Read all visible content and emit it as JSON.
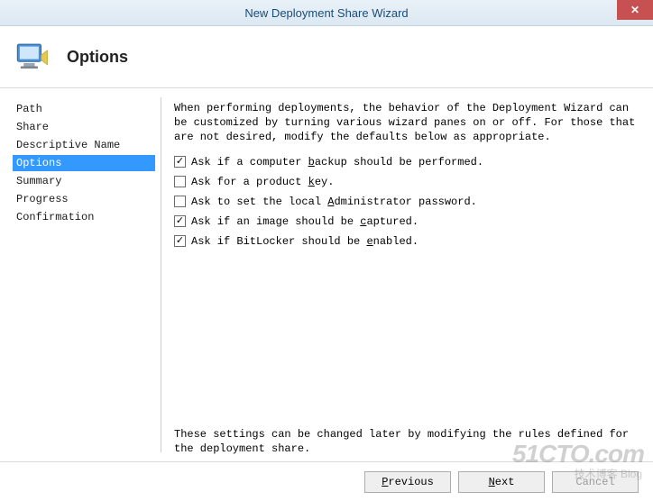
{
  "window": {
    "title": "New Deployment Share Wizard",
    "close_glyph": "✕"
  },
  "header": {
    "title": "Options"
  },
  "sidebar": {
    "items": [
      {
        "label": "Path",
        "selected": false
      },
      {
        "label": "Share",
        "selected": false
      },
      {
        "label": "Descriptive Name",
        "selected": false
      },
      {
        "label": "Options",
        "selected": true
      },
      {
        "label": "Summary",
        "selected": false
      },
      {
        "label": "Progress",
        "selected": false
      },
      {
        "label": "Confirmation",
        "selected": false
      }
    ]
  },
  "content": {
    "intro": "When performing deployments, the behavior of the Deployment Wizard can be customized by turning various wizard panes on or off.  For those that are not desired, modify the defaults below as appropriate.",
    "options": [
      {
        "checked": true,
        "pre": "Ask if a computer ",
        "u": "b",
        "post": "ackup should be performed."
      },
      {
        "checked": false,
        "pre": "Ask for a product ",
        "u": "k",
        "post": "ey."
      },
      {
        "checked": false,
        "pre": "Ask to set the local ",
        "u": "A",
        "post": "dministrator password."
      },
      {
        "checked": true,
        "pre": "Ask if an image should be ",
        "u": "c",
        "post": "aptured."
      },
      {
        "checked": true,
        "pre": "Ask if BitLocker should be ",
        "u": "e",
        "post": "nabled."
      }
    ],
    "footnote": "These settings can be changed later by modifying the rules defined for the deployment share."
  },
  "footer": {
    "previous": {
      "u": "P",
      "rest": "revious"
    },
    "next": {
      "pre": "",
      "u": "N",
      "post": "ext"
    },
    "cancel": "Cancel"
  },
  "watermark": {
    "main": "51CTO.com",
    "sub": "技术博客 Blog"
  }
}
